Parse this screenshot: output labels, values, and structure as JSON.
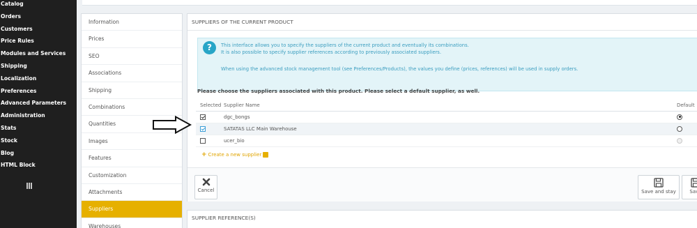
{
  "sidebar": {
    "items": [
      {
        "label": "Catalog"
      },
      {
        "label": "Orders"
      },
      {
        "label": "Customers"
      },
      {
        "label": "Price Rules"
      },
      {
        "label": "Modules and Services"
      },
      {
        "label": "Shipping"
      },
      {
        "label": "Localization"
      },
      {
        "label": "Preferences"
      },
      {
        "label": "Advanced Parameters"
      },
      {
        "label": "Administration"
      },
      {
        "label": "Stats"
      },
      {
        "label": "Stock"
      },
      {
        "label": "Blog"
      },
      {
        "label": "HTML Block"
      }
    ]
  },
  "product_tabs": [
    {
      "label": "Information"
    },
    {
      "label": "Prices"
    },
    {
      "label": "SEO"
    },
    {
      "label": "Associations"
    },
    {
      "label": "Shipping"
    },
    {
      "label": "Combinations"
    },
    {
      "label": "Quantities"
    },
    {
      "label": "Images"
    },
    {
      "label": "Features"
    },
    {
      "label": "Customization"
    },
    {
      "label": "Attachments"
    },
    {
      "label": "Suppliers",
      "active": true
    },
    {
      "label": "Warehouses"
    }
  ],
  "panel": {
    "heading": "SUPPLIERS OF THE CURRENT PRODUCT",
    "info_icon": "question-circle-icon",
    "info_lines": [
      "This interface allows you to specify the suppliers of the current product and eventually its combinations.",
      "It is also possible to specify supplier references according to previously associated suppliers.",
      "When using the advanced stock management tool (see Preferences/Products), the values you define (prices, references) will be used in supply orders."
    ],
    "instruction": "Please choose the suppliers associated with this product. Please select a default supplier, as well.",
    "table": {
      "headers": {
        "selected": "Selected",
        "name": "Supplier Name",
        "default": "Default"
      },
      "rows": [
        {
          "name": "dgc_bongs",
          "selected": true,
          "default": "selected"
        },
        {
          "name": "SATATAS LLC Main Warehouse",
          "selected": true,
          "default": "unselected"
        },
        {
          "name": "ucer_bio",
          "selected": false,
          "default": "disabled"
        }
      ]
    },
    "create_link": "Create a new supplier",
    "buttons": {
      "cancel": "Cancel",
      "save_and_stay": "Save and stay",
      "save": "Save"
    }
  },
  "panel2": {
    "heading": "SUPPLIER REFERENCE(S)"
  },
  "colors": {
    "sidebar_bg": "#1f1f1f",
    "active_tab": "#e6b000",
    "info_bg": "#e3f4f8",
    "info_text": "#3a9dbf"
  }
}
